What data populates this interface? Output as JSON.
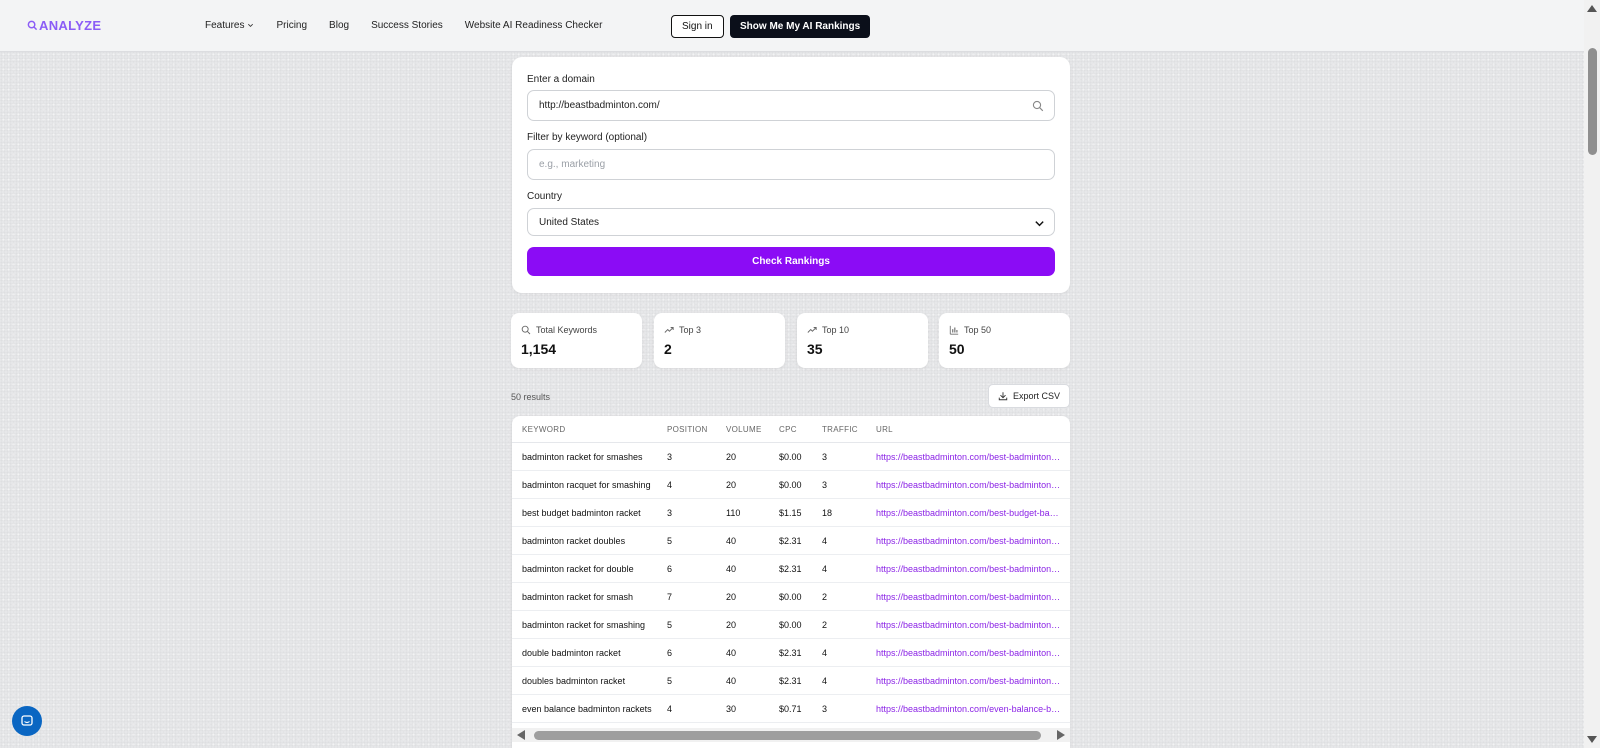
{
  "brand": {
    "name": "ANALYZE",
    "color": "#8b5cf6"
  },
  "nav": {
    "features": "Features",
    "pricing": "Pricing",
    "blog": "Blog",
    "success": "Success Stories",
    "checker": "Website AI Readiness Checker"
  },
  "header": {
    "signin": "Sign in",
    "rankings": "Show Me My AI Rankings"
  },
  "form": {
    "domain_label": "Enter a domain",
    "domain_value": "http://beastbadminton.com/",
    "keyword_label": "Filter by keyword (optional)",
    "keyword_placeholder": "e.g., marketing",
    "country_label": "Country",
    "country_value": "United States",
    "submit": "Check Rankings",
    "accent": "#8b0cf5"
  },
  "stats": [
    {
      "label": "Total Keywords",
      "value": "1,154",
      "icon": "search-icon"
    },
    {
      "label": "Top 3",
      "value": "2",
      "icon": "trending-up-icon"
    },
    {
      "label": "Top 10",
      "value": "35",
      "icon": "trending-up-icon"
    },
    {
      "label": "Top 50",
      "value": "50",
      "icon": "bar-chart-icon"
    }
  ],
  "results": {
    "count": "50 results",
    "export": "Export CSV"
  },
  "table": {
    "columns": [
      "KEYWORD",
      "POSITION",
      "VOLUME",
      "CPC",
      "TRAFFIC",
      "URL"
    ],
    "rows": [
      [
        "badminton racket for smashes",
        "3",
        "20",
        "$0.00",
        "3",
        "https://beastbadminton.com/best-badminton-r..."
      ],
      [
        "badminton racquet for smashing",
        "4",
        "20",
        "$0.00",
        "3",
        "https://beastbadminton.com/best-badminton-r..."
      ],
      [
        "best budget badminton racket",
        "3",
        "110",
        "$1.15",
        "18",
        "https://beastbadminton.com/best-budget-bad..."
      ],
      [
        "badminton racket doubles",
        "5",
        "40",
        "$2.31",
        "4",
        "https://beastbadminton.com/best-badminton-r..."
      ],
      [
        "badminton racket for double",
        "6",
        "40",
        "$2.31",
        "4",
        "https://beastbadminton.com/best-badminton-r..."
      ],
      [
        "badminton racket for smash",
        "7",
        "20",
        "$0.00",
        "2",
        "https://beastbadminton.com/best-badminton-r..."
      ],
      [
        "badminton racket for smashing",
        "5",
        "20",
        "$0.00",
        "2",
        "https://beastbadminton.com/best-badminton-r..."
      ],
      [
        "double badminton racket",
        "6",
        "40",
        "$2.31",
        "4",
        "https://beastbadminton.com/best-badminton-r..."
      ],
      [
        "doubles badminton racket",
        "5",
        "40",
        "$2.31",
        "4",
        "https://beastbadminton.com/best-badminton-r..."
      ],
      [
        "even balance badminton rackets",
        "4",
        "30",
        "$0.71",
        "3",
        "https://beastbadminton.com/even-balance-ba..."
      ]
    ]
  }
}
